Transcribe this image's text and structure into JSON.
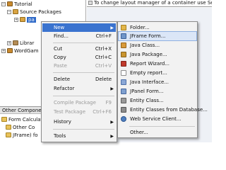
{
  "editor": {
    "hint_text": "To change layout manager of a container use Set Layout in"
  },
  "tree": {
    "root": "Tutorial",
    "source_packages": "Source Packages",
    "selected_package": "pa",
    "libraries": "Librar",
    "project2": "WordGam"
  },
  "other_panel": {
    "header": "Other Compone",
    "rows": [
      "Form Calculat",
      "Other Co",
      "JFrame) fo"
    ]
  },
  "context_menu": {
    "items": [
      {
        "label": "New",
        "shortcut": "",
        "submenu": true,
        "disabled": false,
        "highlighted": true
      },
      {
        "label": "Find...",
        "shortcut": "Ctrl+F",
        "submenu": false,
        "disabled": false,
        "highlighted": false
      },
      {
        "label": "Cut",
        "shortcut": "Ctrl+X",
        "submenu": false,
        "disabled": false,
        "highlighted": false
      },
      {
        "label": "Copy",
        "shortcut": "Ctrl+C",
        "submenu": false,
        "disabled": false,
        "highlighted": false
      },
      {
        "label": "Paste",
        "shortcut": "Ctrl+V",
        "submenu": false,
        "disabled": true,
        "highlighted": false
      },
      {
        "label": "Delete",
        "shortcut": "Delete",
        "submenu": false,
        "disabled": false,
        "highlighted": false
      },
      {
        "label": "Refactor",
        "shortcut": "",
        "submenu": true,
        "disabled": false,
        "highlighted": false
      },
      {
        "label": "Compile Package",
        "shortcut": "F9",
        "submenu": false,
        "disabled": true,
        "highlighted": false
      },
      {
        "label": "Test Package",
        "shortcut": "Ctrl+F6",
        "submenu": false,
        "disabled": true,
        "highlighted": false
      },
      {
        "label": "History",
        "shortcut": "",
        "submenu": true,
        "disabled": false,
        "highlighted": false
      },
      {
        "label": "Tools",
        "shortcut": "",
        "submenu": true,
        "disabled": false,
        "highlighted": false
      }
    ]
  },
  "new_submenu": {
    "items": [
      {
        "label": "Folder...",
        "icon": "folder-icon",
        "color": "#e3b64a"
      },
      {
        "label": "JFrame Form...",
        "icon": "jframe-form-icon",
        "color": "#6f95c9",
        "highlighted": true
      },
      {
        "label": "Java Class...",
        "icon": "java-class-icon",
        "color": "#d89a3a"
      },
      {
        "label": "Java Package...",
        "icon": "java-package-icon",
        "color": "#c9942e"
      },
      {
        "label": "Report Wizard...",
        "icon": "report-wizard-icon",
        "color": "#c0392b"
      },
      {
        "label": "Empty report...",
        "icon": "empty-report-icon",
        "color": "#d0d0d0"
      },
      {
        "label": "Java Interface...",
        "icon": "java-interface-icon",
        "color": "#8aa7d6"
      },
      {
        "label": "JPanel Form...",
        "icon": "jpanel-form-icon",
        "color": "#7e9fce"
      },
      {
        "label": "Entity Class...",
        "icon": "entity-class-icon",
        "color": "#9a9a9a"
      },
      {
        "label": "Entity Classes from Database...",
        "icon": "entity-db-icon",
        "color": "#8c8c8c"
      },
      {
        "label": "Web Service Client...",
        "icon": "web-service-client-icon",
        "color": "#4f7fbf"
      },
      {
        "label": "Other...",
        "icon": "",
        "color": ""
      }
    ]
  },
  "colors": {
    "highlight": "#3a73cf",
    "menu_bg": "#f2f2f2"
  }
}
